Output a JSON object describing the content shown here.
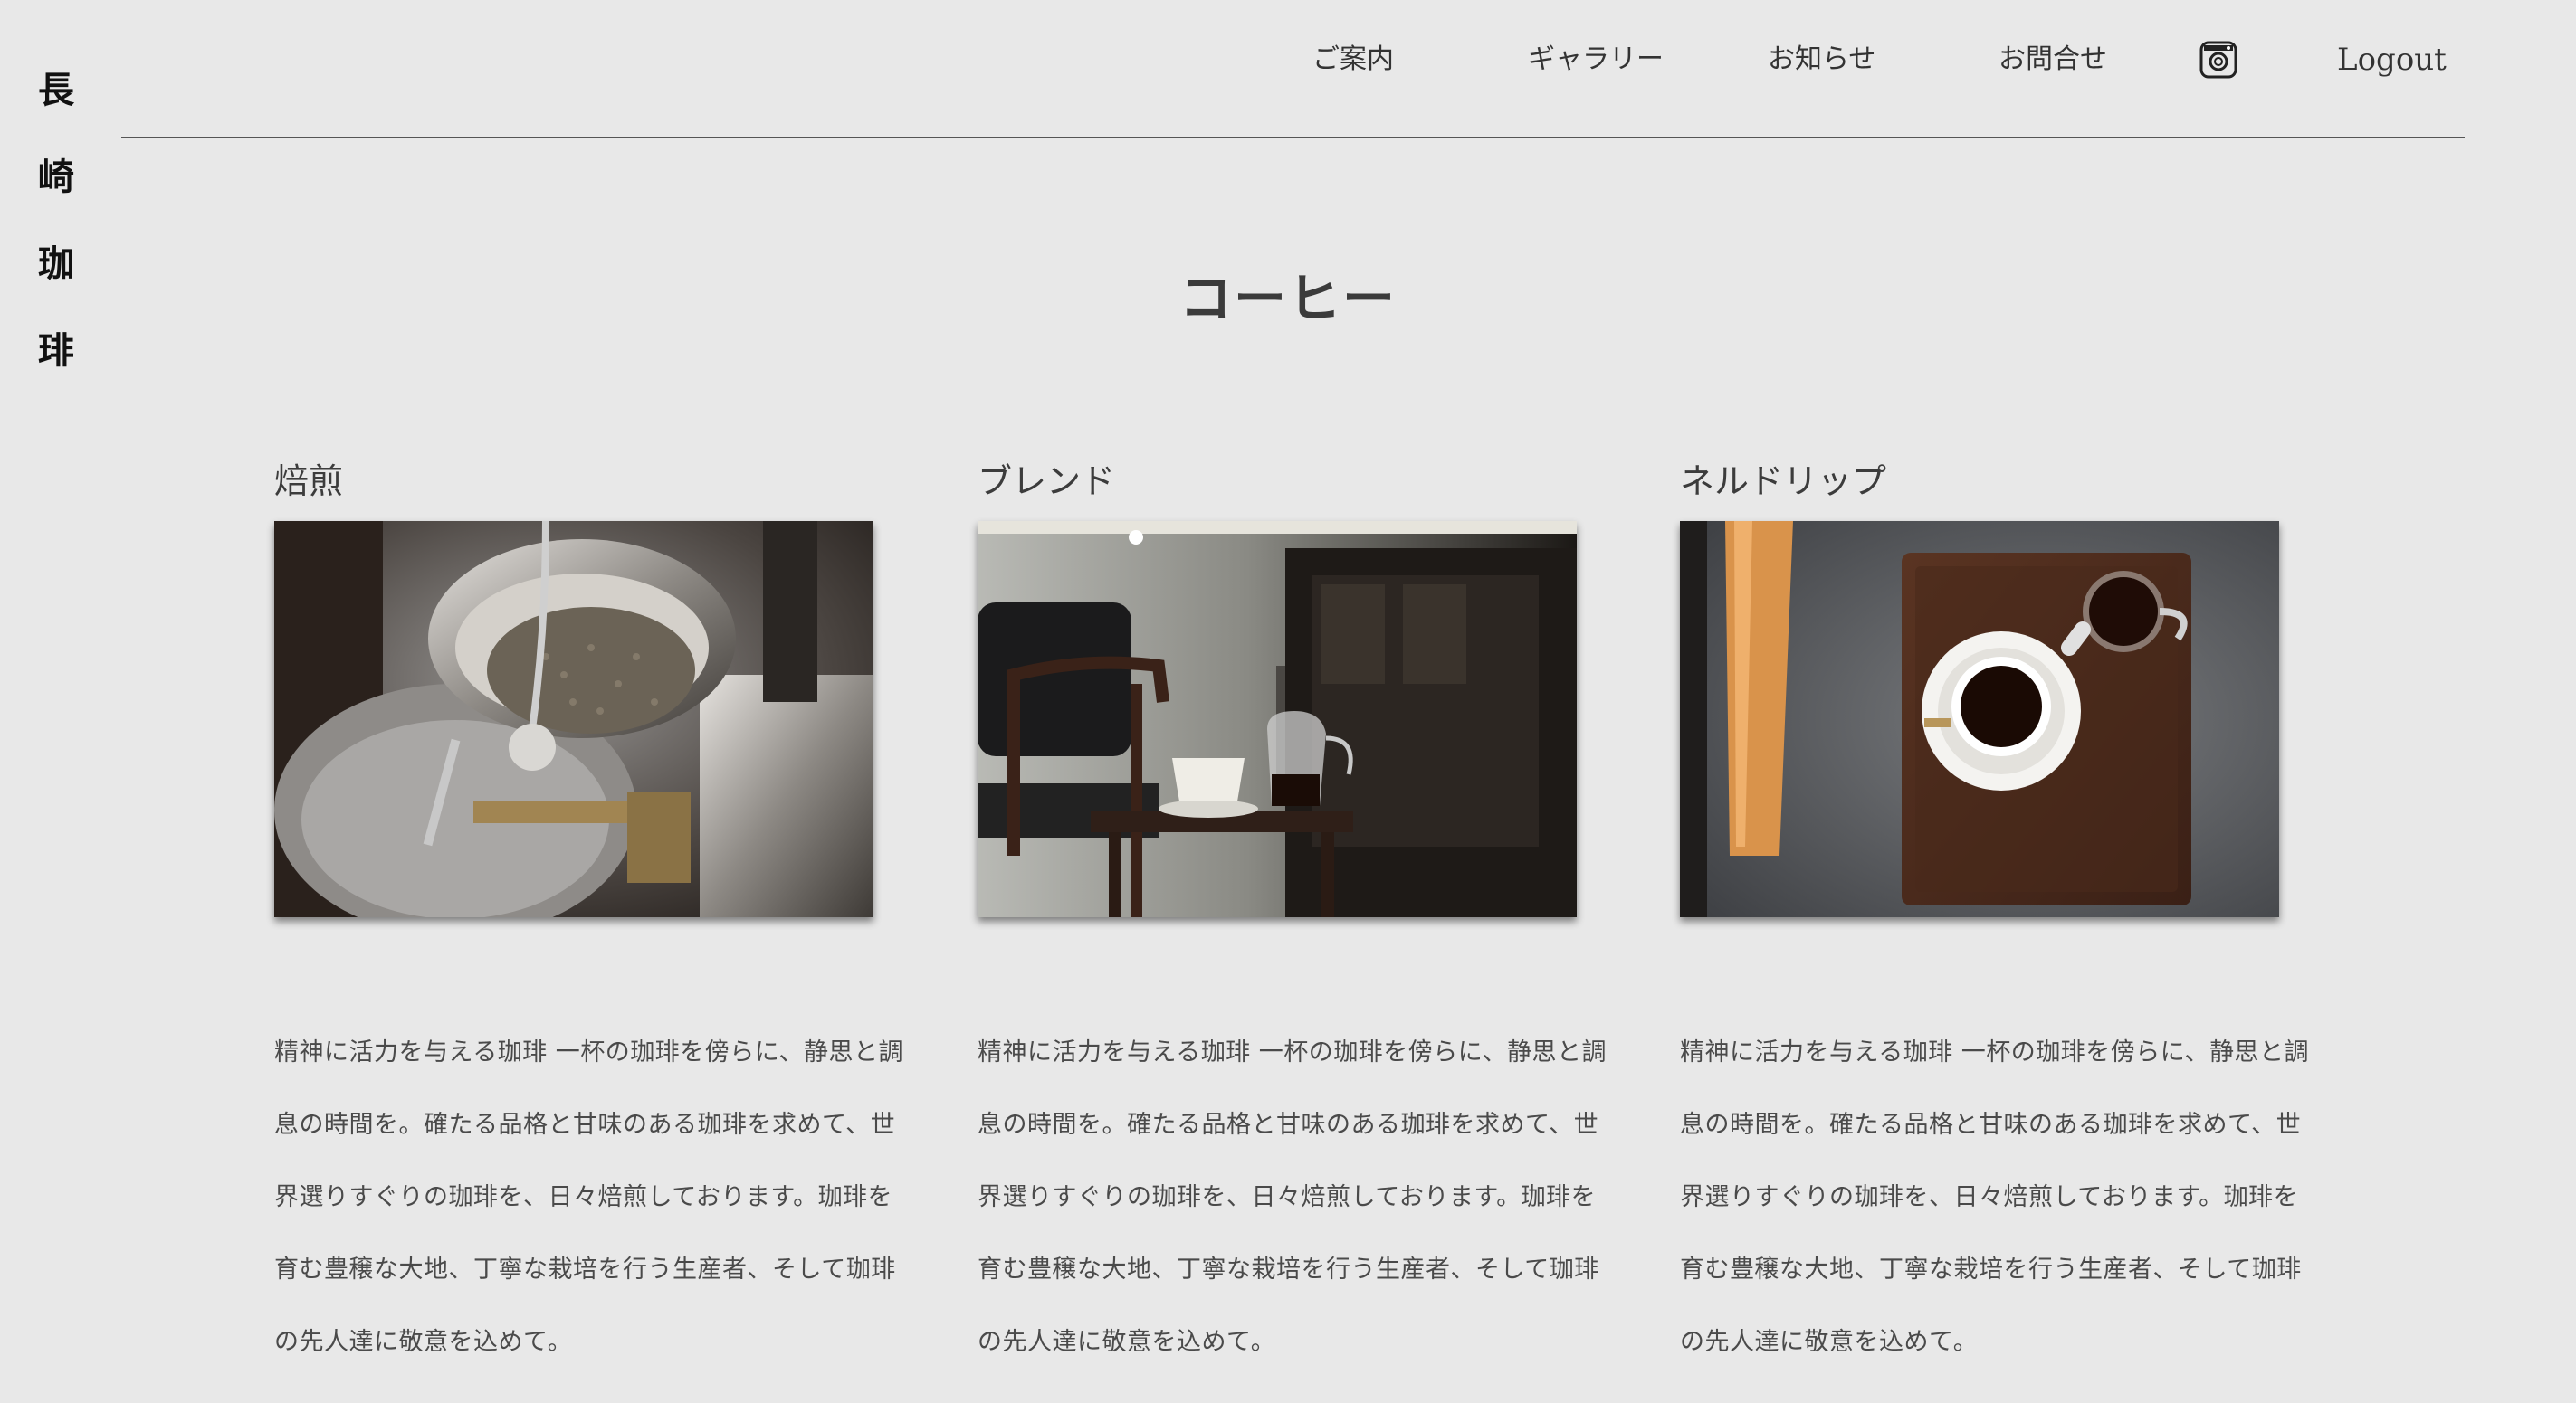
{
  "brand": {
    "chars": [
      "長",
      "崎",
      "珈",
      "琲"
    ]
  },
  "nav": {
    "items": [
      {
        "label": "ご案内"
      },
      {
        "label": "ギャラリー"
      },
      {
        "label": "お知らせ"
      },
      {
        "label": "お問合せ"
      }
    ],
    "instagram_icon": "instagram-icon",
    "logout_label": "Logout"
  },
  "page": {
    "title": "コーヒー"
  },
  "cards": [
    {
      "title": "焙煎",
      "image": "coffee-roaster-photo",
      "text": "精神に活力を与える珈琲 一杯の珈琲を傍らに、静思と調息の時間を。確たる品格と甘味のある珈琲を求めて、世界選りすぐりの珈琲を、日々焙煎しております。珈琲を育む豊穣な大地、丁寧な栽培を行う生産者、そして珈琲の先人達に敬意を込めて。"
    },
    {
      "title": "ブレンド",
      "image": "cafe-interior-photo",
      "text": "精神に活力を与える珈琲 一杯の珈琲を傍らに、静思と調息の時間を。確たる品格と甘味のある珈琲を求めて、世界選りすぐりの珈琲を、日々焙煎しております。珈琲を育む豊穣な大地、丁寧な栽培を行う生産者、そして珈琲の先人達に敬意を込めて。"
    },
    {
      "title": "ネルドリップ",
      "image": "coffee-cup-on-tray-photo",
      "text": "精神に活力を与える珈琲 一杯の珈琲を傍らに、静思と調息の時間を。確たる品格と甘味のある珈琲を求めて、世界選りすぐりの珈琲を、日々焙煎しております。珈琲を育む豊穣な大地、丁寧な栽培を行う生産者、そして珈琲の先人達に敬意を込めて。"
    }
  ]
}
